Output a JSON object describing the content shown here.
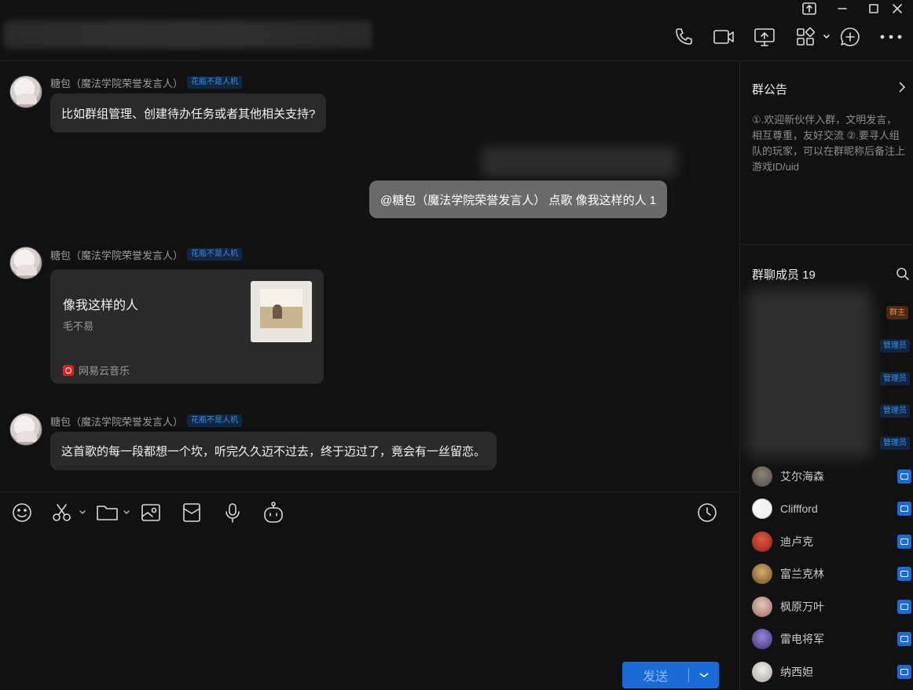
{
  "window": {
    "title_blurred": true
  },
  "chat": {
    "messages": [
      {
        "sender": "糖包（魔法学院荣誉发言人）",
        "badge": "花瓶不是人机",
        "text": "比如群组管理、创建待办任务或者其他相关支持?"
      },
      {
        "self": true,
        "text": "@糖包（魔法学院荣誉发言人） 点歌 像我这样的人 1"
      },
      {
        "sender": "糖包（魔法学院荣誉发言人）",
        "badge": "花瓶不是人机",
        "card": {
          "title": "像我这样的人",
          "artist": "毛不易",
          "source": "网易云音乐"
        }
      },
      {
        "sender": "糖包（魔法学院荣誉发言人）",
        "badge": "花瓶不是人机",
        "text": "这首歌的每一段都想一个坎，听完久久迈不过去，终于迈过了，竟会有一丝留恋。"
      }
    ]
  },
  "composer": {
    "send_label": "发送",
    "tools": [
      "emoji-icon",
      "scissors-icon",
      "folder-icon",
      "image-icon",
      "red-packet-icon",
      "microphone-icon",
      "robot-icon",
      "history-icon"
    ]
  },
  "side": {
    "notice_title": "群公告",
    "notice_text": "①.欢迎新伙伴入群，文明发言，相互尊重，友好交流 ②.要寻人组队的玩家，可以在群昵称后备注上游戏ID/uid",
    "members_title": "群聊成员 19",
    "roles": [
      "群主",
      "管理员",
      "管理员",
      "管理员",
      "管理员"
    ],
    "members": [
      {
        "name": "艾尔海森",
        "color": "#6e6a5e"
      },
      {
        "name": "Cliffford",
        "color": "#f4f4f4"
      },
      {
        "name": "迪卢克",
        "color": "#b8342a"
      },
      {
        "name": "富兰克林",
        "color": "#b88a3e"
      },
      {
        "name": "枫原万叶",
        "color": "#c9a39a"
      },
      {
        "name": "雷电将军",
        "color": "#6a55a8"
      },
      {
        "name": "纳西妲",
        "color": "#d9d4cf"
      }
    ]
  },
  "colors": {
    "background": "#111111",
    "bubble": "#2a2a2a",
    "self_bubble": "#6a6a6a",
    "accent": "#1a6bd6"
  }
}
